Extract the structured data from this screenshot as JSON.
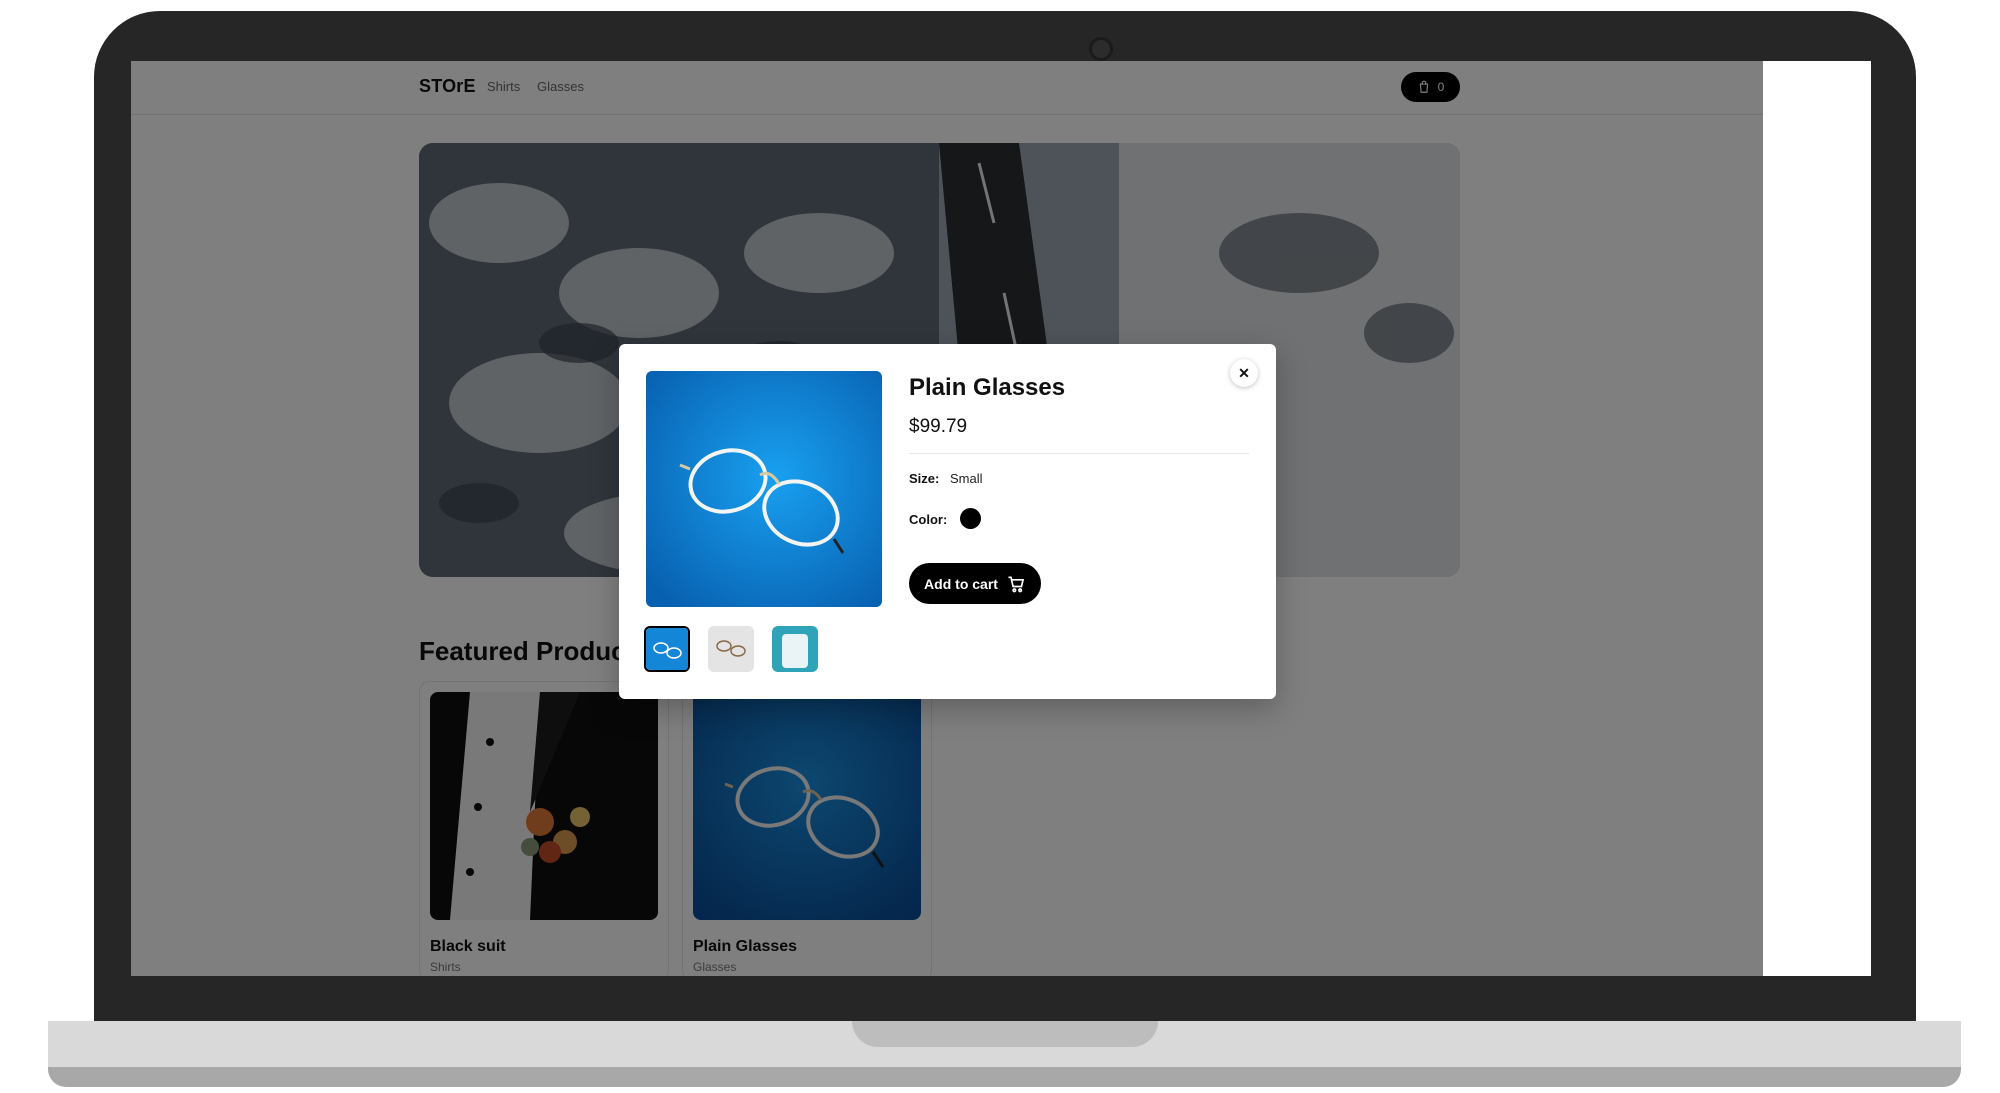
{
  "store": {
    "brand": "STOrE",
    "nav": [
      {
        "label": "Shirts"
      },
      {
        "label": "Glasses"
      }
    ],
    "cart_count": "0"
  },
  "featured": {
    "title": "Featured Products",
    "products": [
      {
        "name": "Black suit",
        "category": "Shirts"
      },
      {
        "name": "Plain Glasses",
        "category": "Glasses"
      }
    ]
  },
  "modal": {
    "title": "Plain Glasses",
    "price": "$99.79",
    "size_label": "Size:",
    "size_value": "Small",
    "color_label": "Color:",
    "color_value": "#000000",
    "add_to_cart": "Add to cart",
    "close_glyph": "✕",
    "selected_thumbnail": 1
  },
  "icons": {
    "cart": "cart-icon",
    "bag": "shopping-bag-icon",
    "close": "close-icon"
  },
  "colors": {
    "overlay": "rgba(0,0,0,0.5)",
    "primary_button": "#000000",
    "modal_bg": "#ffffff"
  }
}
